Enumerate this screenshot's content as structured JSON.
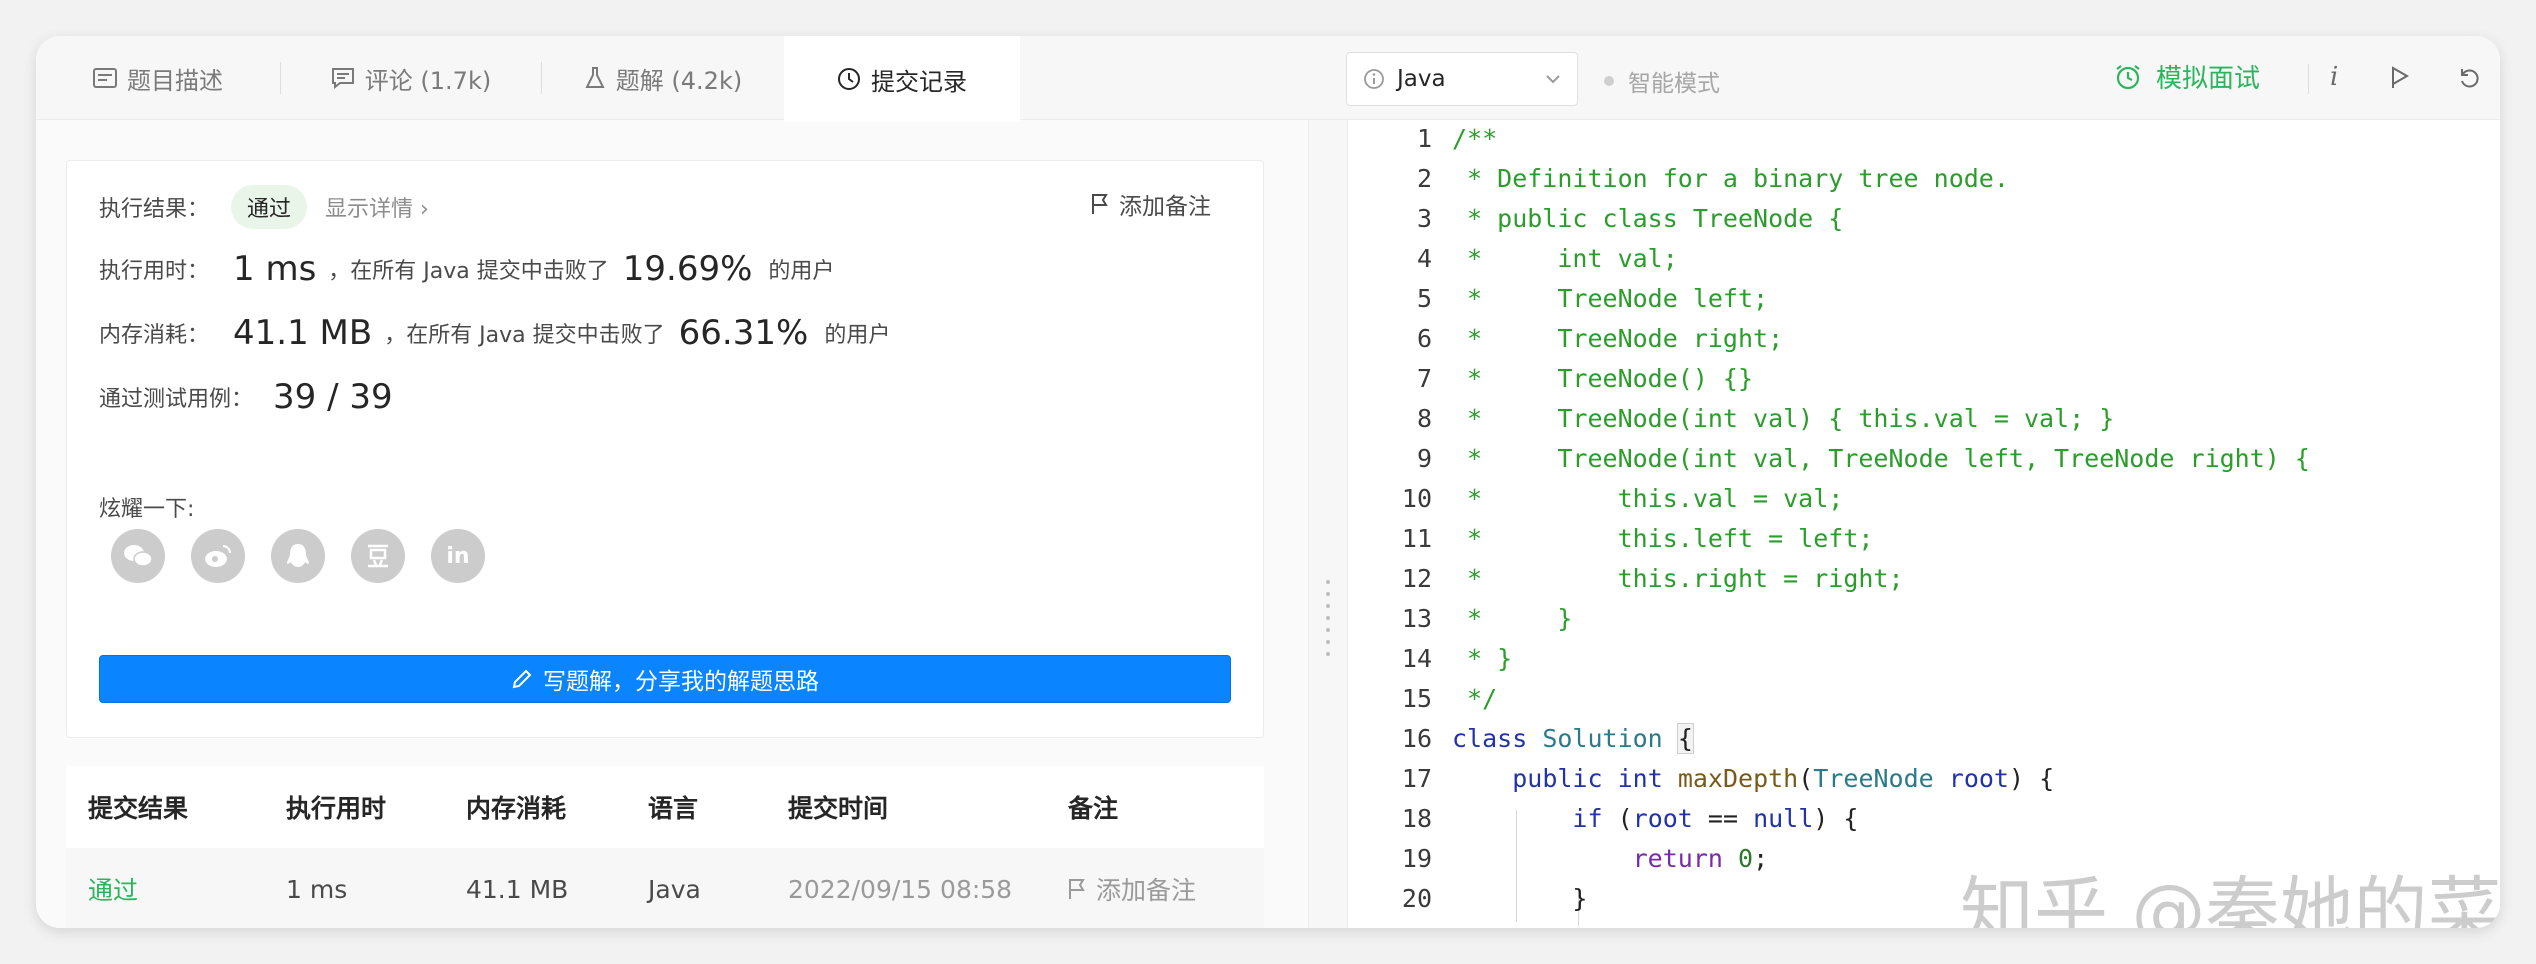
{
  "tabs": [
    {
      "label": "题目描述",
      "icon": "description-icon"
    },
    {
      "label": "评论 (1.7k)",
      "icon": "comment-icon"
    },
    {
      "label": "题解 (4.2k)",
      "icon": "flask-icon"
    },
    {
      "label": "提交记录",
      "icon": "clock-icon"
    }
  ],
  "result": {
    "status_label": "执行结果：",
    "status_value": "通过",
    "detail_link": "显示详情",
    "note_button": "添加备注",
    "time_label": "执行用时：",
    "time_value": "1 ms",
    "time_mid": "，在所有 Java 提交中击败了",
    "time_pct": "19.69%",
    "time_tail": "的用户",
    "mem_label": "内存消耗：",
    "mem_value": "41.1 MB",
    "mem_mid": "，在所有 Java 提交中击败了",
    "mem_pct": "66.31%",
    "mem_tail": "的用户",
    "cases_label": "通过测试用例：",
    "cases_value": "39 / 39",
    "share_label": "炫耀一下:",
    "share_icons": [
      "wechat-icon",
      "weibo-icon",
      "qq-icon",
      "douban-icon",
      "linkedin-icon"
    ],
    "write_button": "写题解，分享我的解题思路"
  },
  "table": {
    "headers": [
      "提交结果",
      "执行用时",
      "内存消耗",
      "语言",
      "提交时间",
      "备注"
    ],
    "rows": [
      {
        "result": "通过",
        "time": "1 ms",
        "memory": "41.1 MB",
        "language": "Java",
        "submitted": "2022/09/15 08:58",
        "note": "添加备注"
      }
    ]
  },
  "editor_toolbar": {
    "language": "Java",
    "smart_mode": "智能模式",
    "mock_interview": "模拟面试"
  },
  "code_lines": [
    "/**",
    " * Definition for a binary tree node.",
    " * public class TreeNode {",
    " *     int val;",
    " *     TreeNode left;",
    " *     TreeNode right;",
    " *     TreeNode() {}",
    " *     TreeNode(int val) { this.val = val; }",
    " *     TreeNode(int val, TreeNode left, TreeNode right) {",
    " *         this.val = val;",
    " *         this.left = left;",
    " *         this.right = right;",
    " *     }",
    " * }",
    " */",
    "class Solution {",
    "    public int maxDepth(TreeNode root) {",
    "        if (root == null) {",
    "            return 0;",
    "        }"
  ],
  "watermark": "知乎 @秦她的菜",
  "colors": {
    "accent_blue": "#0a84ff",
    "pass_green": "#2db55d",
    "comment_green": "#2a9d2a"
  }
}
